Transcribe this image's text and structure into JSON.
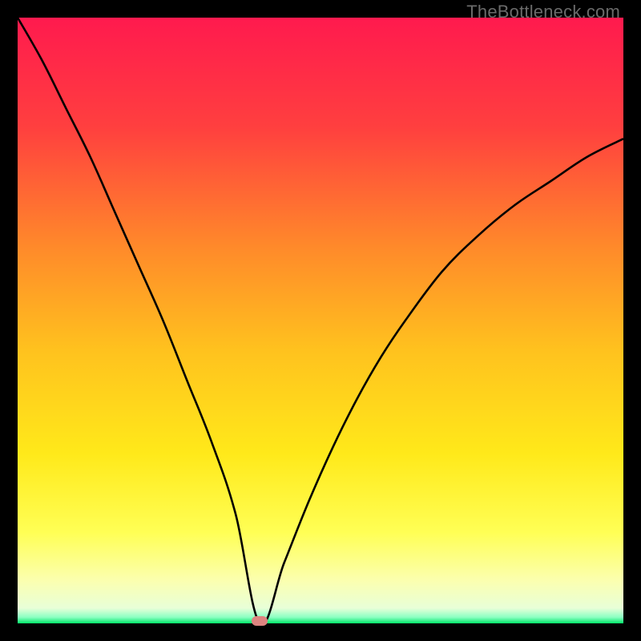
{
  "watermark": "TheBottleneck.com",
  "chart_data": {
    "type": "line",
    "title": "",
    "xlabel": "",
    "ylabel": "",
    "xlim": [
      0,
      100
    ],
    "ylim": [
      0,
      100
    ],
    "gradient_colors": {
      "top": "#ff1a4e",
      "upper_mid": "#ff6a2a",
      "mid": "#ffd400",
      "lower_mid": "#ffff66",
      "low": "#f7ffd6",
      "bottom_line": "#00e667"
    },
    "marker": {
      "x": 40,
      "y": 0,
      "color": "#dd8480"
    },
    "series": [
      {
        "name": "bottleneck-curve",
        "x": [
          0,
          4,
          8,
          12,
          16,
          20,
          24,
          28,
          32,
          36,
          40,
          44,
          48,
          52,
          56,
          60,
          64,
          70,
          76,
          82,
          88,
          94,
          100
        ],
        "y": [
          100,
          93,
          85,
          77,
          68,
          59,
          50,
          40,
          30,
          18,
          0,
          10,
          20,
          29,
          37,
          44,
          50,
          58,
          64,
          69,
          73,
          77,
          80
        ]
      }
    ]
  }
}
